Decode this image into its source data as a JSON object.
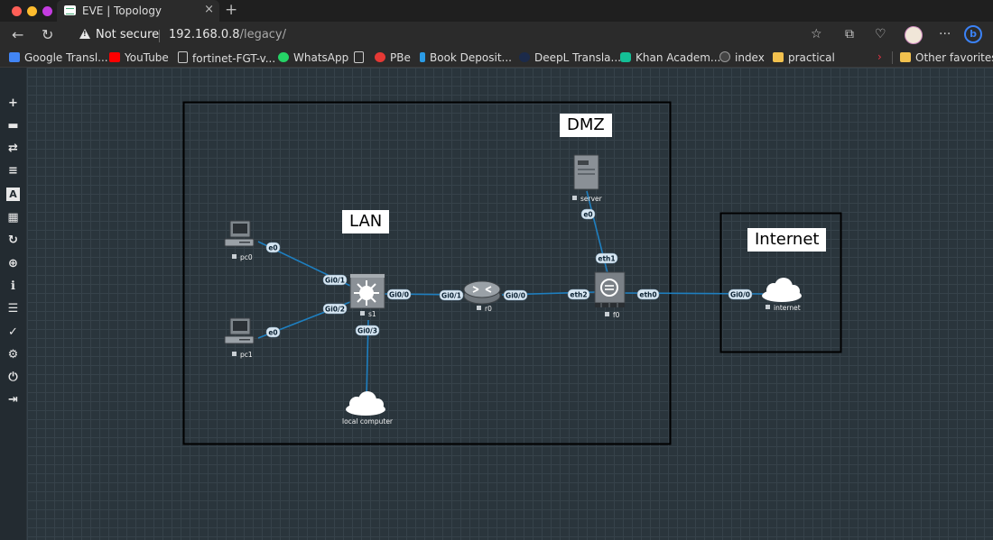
{
  "browser": {
    "tab_title": "EVE | Topology",
    "tab_close": "×",
    "new_tab": "+",
    "security_label": "Not secure",
    "url_host": "192.168.0.8",
    "url_path": "/legacy/",
    "bookmarks": [
      {
        "label": "Google Transl...",
        "icon_color": "#4285f4"
      },
      {
        "label": "YouTube",
        "icon_color": "#ff0000"
      },
      {
        "label": "fortinet-FGT-v...",
        "icon_color": "#cccccc"
      },
      {
        "label": "WhatsApp",
        "icon_color": "#25d366"
      },
      {
        "label": "",
        "icon_color": "#cccccc"
      },
      {
        "label": "PBe",
        "icon_color": "#e53935"
      },
      {
        "label": "Book Deposit...",
        "icon_color": "#2b9be6"
      },
      {
        "label": "DeepL Transla...",
        "icon_color": "#1b2a4a"
      },
      {
        "label": "Khan Academ...",
        "icon_color": "#14bf96"
      },
      {
        "label": "index",
        "icon_color": "#444444"
      },
      {
        "label": "practical",
        "icon_color": "#f2c14e"
      }
    ],
    "other_favorites": "Other favorites"
  },
  "sidebar_tools": [
    {
      "name": "add-icon",
      "glyph": "+"
    },
    {
      "name": "nodes-icon",
      "glyph": "▬"
    },
    {
      "name": "networks-icon",
      "glyph": "⇄"
    },
    {
      "name": "startup-configs-icon",
      "glyph": "≡"
    },
    {
      "name": "text-icon",
      "glyph": "A"
    },
    {
      "name": "grid-icon",
      "glyph": "▦"
    },
    {
      "name": "refresh-icon",
      "glyph": "↻"
    },
    {
      "name": "zoom-icon",
      "glyph": "⊕"
    },
    {
      "name": "info-icon",
      "glyph": "ℹ"
    },
    {
      "name": "list-icon",
      "glyph": "☰"
    },
    {
      "name": "check-icon",
      "glyph": "✓"
    },
    {
      "name": "settings-icon",
      "glyph": "⚙"
    },
    {
      "name": "power-icon",
      "glyph": "⏻"
    },
    {
      "name": "logout-icon",
      "glyph": "⇥"
    }
  ],
  "zones": {
    "lan": "LAN",
    "dmz": "DMZ",
    "internet": "Internet"
  },
  "nodes": {
    "pc0": "pc0",
    "pc1": "pc1",
    "s1": "s1",
    "r0": "r0",
    "f0": "f0",
    "server": "server",
    "internet": "internet",
    "local_computer": "local computer"
  },
  "interfaces": {
    "pc0_e0": "e0",
    "pc1_e0": "e0",
    "s1_gi01": "Gi0/1",
    "s1_gi02": "Gi0/2",
    "s1_gi00": "Gi0/0",
    "s1_gi03": "Gi0/3",
    "r0_gi01": "Gi0/1",
    "r0_gi00": "Gi0/0",
    "f0_eth2": "eth2",
    "f0_eth1": "eth1",
    "f0_eth0": "eth0",
    "server_e0": "e0",
    "internet_gi00": "Gi0/0"
  },
  "colors": {
    "link": "#1e7fc0",
    "iface_fill": "#d7e6f2",
    "canvas": "#2a353c"
  }
}
